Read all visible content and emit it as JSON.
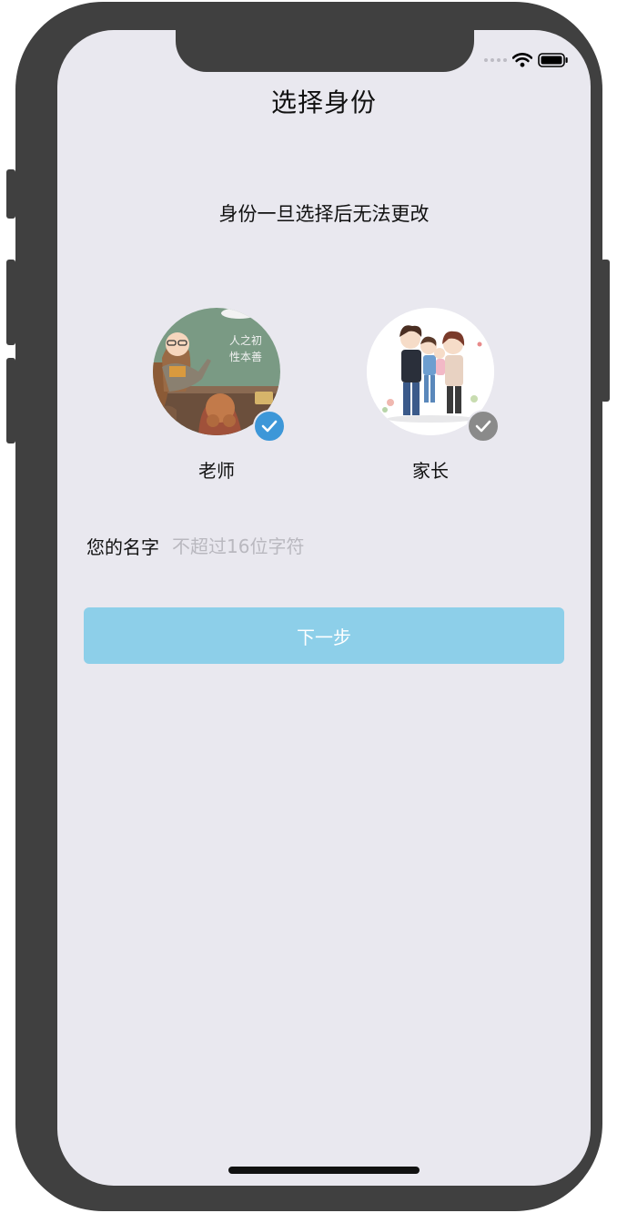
{
  "screen": {
    "title": "选择身份",
    "subtitle": "身份一旦选择后无法更改"
  },
  "roles": [
    {
      "label": "老师",
      "selected": true,
      "badge_color": "#3d97d8",
      "avatar_icon": "teacher-illustration",
      "blackboard_text_1": "人之初",
      "blackboard_text_2": "性本善"
    },
    {
      "label": "家长",
      "selected": false,
      "badge_color": "#8a8a8a",
      "avatar_icon": "family-illustration"
    }
  ],
  "name_field": {
    "label": "您的名字",
    "placeholder": "不超过16位字符",
    "value": ""
  },
  "next_button": {
    "label": "下一步",
    "color": "#8dcfe9"
  },
  "colors": {
    "background": "#e9e8ef",
    "frame": "#404040"
  }
}
